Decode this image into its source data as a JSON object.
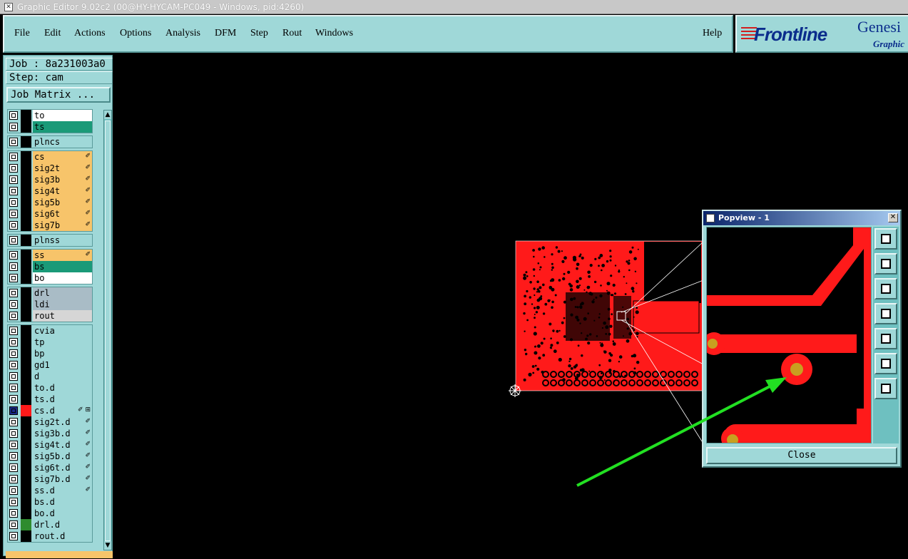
{
  "window": {
    "title": "Graphic Editor 9.02c2 (00@HY-HYCAM-PC049 - Windows, pid:4260)"
  },
  "menu": {
    "items": [
      "File",
      "Edit",
      "Actions",
      "Options",
      "Analysis",
      "DFM",
      "Step",
      "Rout",
      "Windows"
    ],
    "help": "Help"
  },
  "brand": {
    "name": "Frontline",
    "product": "Genesi",
    "sub": "Graphic"
  },
  "job": {
    "line": "Job : 8a231003a0",
    "step": "Step: cam",
    "matrix_btn": "Job Matrix ..."
  },
  "layers": [
    {
      "name": "to",
      "color": "#ffffff"
    },
    {
      "name": "ts",
      "color": "#1a9a78"
    },
    {
      "name": "plncs",
      "color": "#9fd8d8"
    },
    {
      "name": "cs",
      "color": "#f7c46a",
      "mark": "✐"
    },
    {
      "name": "sig2t",
      "color": "#f7c46a",
      "mark": "✐"
    },
    {
      "name": "sig3b",
      "color": "#f7c46a",
      "mark": "✐"
    },
    {
      "name": "sig4t",
      "color": "#f7c46a",
      "mark": "✐"
    },
    {
      "name": "sig5b",
      "color": "#f7c46a",
      "mark": "✐"
    },
    {
      "name": "sig6t",
      "color": "#f7c46a",
      "mark": "✐"
    },
    {
      "name": "sig7b",
      "color": "#f7c46a",
      "mark": "✐"
    },
    {
      "name": "plnss",
      "color": "#9fd8d8"
    },
    {
      "name": "ss",
      "color": "#f7c46a",
      "mark": "✐"
    },
    {
      "name": "bs",
      "color": "#1a9a78"
    },
    {
      "name": "bo",
      "color": "#ffffff"
    },
    {
      "name": "drl",
      "color": "#a9bcc6"
    },
    {
      "name": "ldi",
      "color": "#a9bcc6"
    },
    {
      "name": "rout",
      "color": "#d6d6d6"
    },
    {
      "name": "cvia",
      "color": "#9fd8d8"
    },
    {
      "name": "tp",
      "color": "#9fd8d8"
    },
    {
      "name": "bp",
      "color": "#9fd8d8"
    },
    {
      "name": "gd1",
      "color": "#9fd8d8"
    },
    {
      "name": "d",
      "color": "#9fd8d8"
    },
    {
      "name": "to.d",
      "color": "#9fd8d8"
    },
    {
      "name": "ts.d",
      "color": "#9fd8d8"
    },
    {
      "name": "cs.d",
      "color": "#9fd8d8",
      "mark": "✐ ⊞",
      "active": true
    },
    {
      "name": "sig2t.d",
      "color": "#9fd8d8",
      "mark": "✐"
    },
    {
      "name": "sig3b.d",
      "color": "#9fd8d8",
      "mark": "✐"
    },
    {
      "name": "sig4t.d",
      "color": "#9fd8d8",
      "mark": "✐"
    },
    {
      "name": "sig5b.d",
      "color": "#9fd8d8",
      "mark": "✐"
    },
    {
      "name": "sig6t.d",
      "color": "#9fd8d8",
      "mark": "✐"
    },
    {
      "name": "sig7b.d",
      "color": "#9fd8d8",
      "mark": "✐"
    },
    {
      "name": "ss.d",
      "color": "#9fd8d8",
      "mark": "✐"
    },
    {
      "name": "bs.d",
      "color": "#9fd8d8"
    },
    {
      "name": "bo.d",
      "color": "#9fd8d8"
    },
    {
      "name": "drl.d",
      "color": "#9fd8d8",
      "swatch": "#2e8b2e"
    },
    {
      "name": "rout.d",
      "color": "#9fd8d8"
    }
  ],
  "popview": {
    "title": "Popview - 1",
    "close_label": "Close"
  },
  "colors": {
    "panel": "#9fd8d8",
    "copper": "#ff1a1a",
    "pad_center": "#c8a020",
    "arrow": "#22e022"
  }
}
